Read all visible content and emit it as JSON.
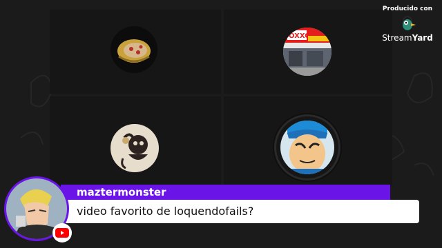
{
  "branding": {
    "produced_by": "Producido con",
    "logo_part1": "Stream",
    "logo_part2": "Yard",
    "icon": "streamyard-bird-icon"
  },
  "participants": [
    {
      "name": "participant-1",
      "avatar": "pizza-ring-avatar"
    },
    {
      "name": "participant-2",
      "avatar": "oxxo-store-avatar"
    },
    {
      "name": "participant-3",
      "avatar": "monkey-cartoon-avatar"
    },
    {
      "name": "participant-4",
      "avatar": "cartoon-face-avatar"
    }
  ],
  "comment": {
    "author": "maztermonster",
    "text": "video favorito de loquendofails?",
    "platform_icon": "youtube-icon",
    "colors": {
      "bar": "#6a14e8",
      "box": "#ffffff"
    }
  }
}
